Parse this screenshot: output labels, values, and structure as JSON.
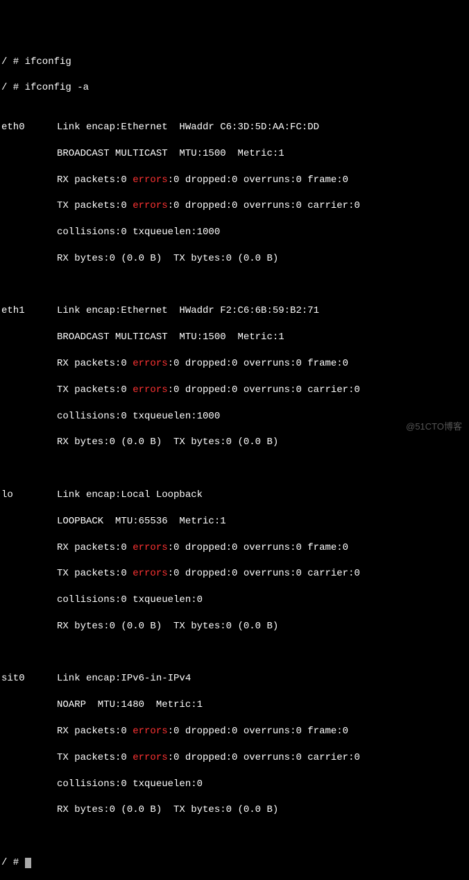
{
  "prompt1": "/ # ifconfig",
  "prompt2": "/ # ifconfig -a",
  "prompt3_prefix": "/ # ",
  "eth0": {
    "name": "eth0",
    "l1": "Link encap:Ethernet  HWaddr C6:3D:5D:AA:FC:DD",
    "l2": "BROADCAST MULTICAST  MTU:1500  Metric:1",
    "l3a": "RX packets:0 ",
    "l3err": "errors",
    "l3b": ":0 dropped:0 overruns:0 frame:0",
    "l4a": "TX packets:0 ",
    "l4err": "errors",
    "l4b": ":0 dropped:0 overruns:0 carrier:0",
    "l5": "collisions:0 txqueuelen:1000",
    "l6": "RX bytes:0 (0.0 B)  TX bytes:0 (0.0 B)"
  },
  "eth1": {
    "name": "eth1",
    "l1": "Link encap:Ethernet  HWaddr F2:C6:6B:59:B2:71",
    "l2": "BROADCAST MULTICAST  MTU:1500  Metric:1",
    "l3a": "RX packets:0 ",
    "l3err": "errors",
    "l3b": ":0 dropped:0 overruns:0 frame:0",
    "l4a": "TX packets:0 ",
    "l4err": "errors",
    "l4b": ":0 dropped:0 overruns:0 carrier:0",
    "l5": "collisions:0 txqueuelen:1000",
    "l6": "RX bytes:0 (0.0 B)  TX bytes:0 (0.0 B)"
  },
  "lo": {
    "name": "lo",
    "l1": "Link encap:Local Loopback",
    "l2": "LOOPBACK  MTU:65536  Metric:1",
    "l3a": "RX packets:0 ",
    "l3err": "errors",
    "l3b": ":0 dropped:0 overruns:0 frame:0",
    "l4a": "TX packets:0 ",
    "l4err": "errors",
    "l4b": ":0 dropped:0 overruns:0 carrier:0",
    "l5": "collisions:0 txqueuelen:0",
    "l6": "RX bytes:0 (0.0 B)  TX bytes:0 (0.0 B)"
  },
  "sit0": {
    "name": "sit0",
    "l1": "Link encap:IPv6-in-IPv4",
    "l2": "NOARP  MTU:1480  Metric:1",
    "l3a": "RX packets:0 ",
    "l3err": "errors",
    "l3b": ":0 dropped:0 overruns:0 frame:0",
    "l4a": "TX packets:0 ",
    "l4err": "errors",
    "l4b": ":0 dropped:0 overruns:0 carrier:0",
    "l5": "collisions:0 txqueuelen:0",
    "l6": "RX bytes:0 (0.0 B)  TX bytes:0 (0.0 B)"
  },
  "watermark": "@51CTO博客"
}
